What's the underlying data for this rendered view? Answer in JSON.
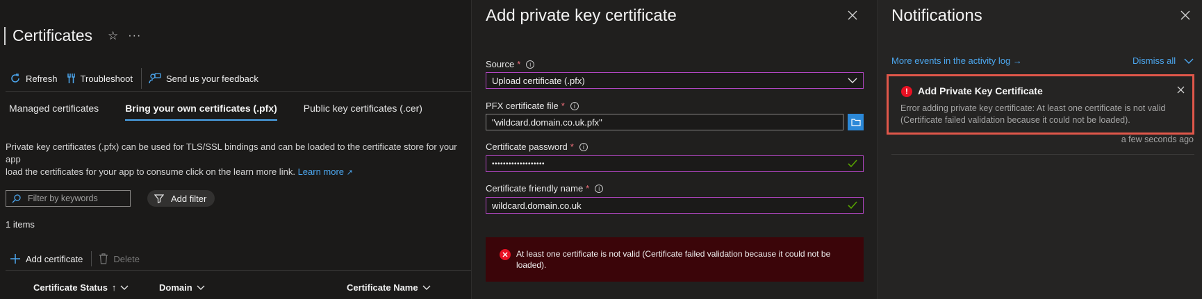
{
  "left": {
    "title": "Certificates",
    "toolbar": {
      "refresh": "Refresh",
      "troubleshoot": "Troubleshoot",
      "feedback": "Send us your feedback"
    },
    "tabs": [
      {
        "label": "Managed certificates",
        "active": false
      },
      {
        "label": "Bring your own certificates (.pfx)",
        "active": true
      },
      {
        "label": "Public key certificates (.cer)",
        "active": false
      }
    ],
    "description_line1": "Private key certificates (.pfx) can be used for TLS/SSL bindings and can be loaded to the certificate store for your app",
    "description_line2": "load the certificates for your app to consume click on the learn more link.",
    "learn_more": "Learn more",
    "filter_placeholder": "Filter by keywords",
    "add_filter": "Add filter",
    "items_count": "1 items",
    "actions": {
      "add_certificate": "Add certificate",
      "delete": "Delete"
    },
    "columns": [
      "Certificate Status",
      "Domain",
      "Certificate Name"
    ],
    "sort_arrow": "↑"
  },
  "blade": {
    "title": "Add private key certificate",
    "fields": {
      "source_label": "Source",
      "source_value": "Upload certificate (.pfx)",
      "pfx_label": "PFX certificate file",
      "pfx_value": "\"wildcard.domain.co.uk.pfx\"",
      "password_label": "Certificate password",
      "password_value": "•••••••••••••••••••",
      "friendly_label": "Certificate friendly name",
      "friendly_value": "wildcard.domain.co.uk"
    },
    "required_mark": "*",
    "info_mark": "i",
    "error_line1": "At least one certificate is not valid (Certificate failed validation because it could not be",
    "error_line2": "loaded)."
  },
  "notifications": {
    "title": "Notifications",
    "activity_link": "More events in the activity log →",
    "dismiss_all": "Dismiss all",
    "item": {
      "title": "Add Private Key Certificate",
      "body_line1": "Error adding private key certificate: At least one certificate is not valid",
      "body_line2": "(Certificate failed validation because it could not be loaded).",
      "time": "a few seconds ago",
      "icon_glyph": "!"
    }
  },
  "colors": {
    "accent": "#4ca7ef",
    "error": "#e81123",
    "focus_border": "#b146c2",
    "notification_highlight": "#e0574a"
  }
}
